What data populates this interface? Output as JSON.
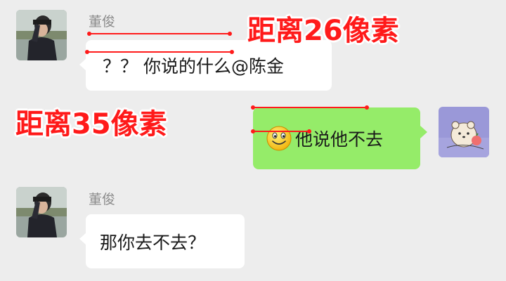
{
  "messages": [
    {
      "sender": "董俊",
      "side": "left",
      "text": "？？ 你说的什么@陈金"
    },
    {
      "sender": "",
      "side": "right",
      "emoji": "smiley-emoji",
      "text": "他说他不去"
    },
    {
      "sender": "董俊",
      "side": "left",
      "text": "那你去不去？"
    }
  ],
  "annotations": {
    "top": "距离26像素",
    "middle": "距离35像素"
  },
  "colors": {
    "background": "#ededed",
    "bubble_left": "#ffffff",
    "bubble_right": "#95ec69",
    "sender_name": "#8c8c8c",
    "annotation": "#ff1a1a"
  }
}
